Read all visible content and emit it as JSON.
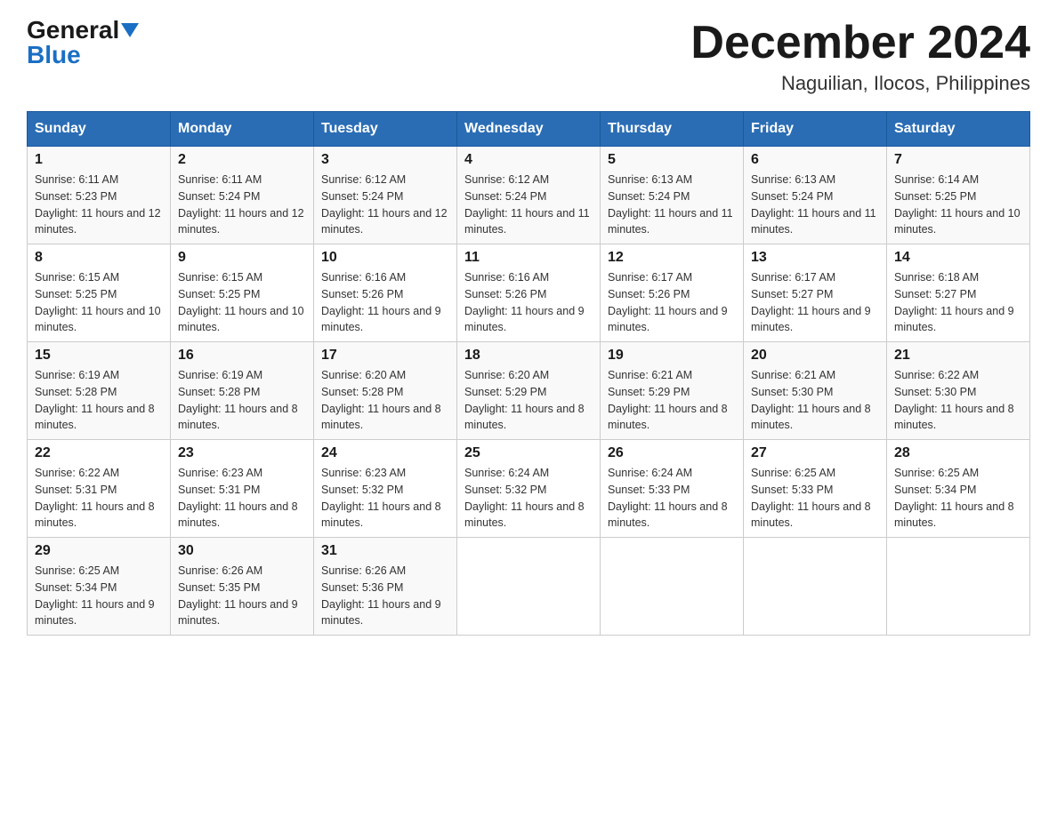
{
  "logo": {
    "general": "General",
    "blue": "Blue"
  },
  "title": {
    "month_year": "December 2024",
    "location": "Naguilian, Ilocos, Philippines"
  },
  "days_of_week": [
    "Sunday",
    "Monday",
    "Tuesday",
    "Wednesday",
    "Thursday",
    "Friday",
    "Saturday"
  ],
  "weeks": [
    [
      {
        "day": "1",
        "sunrise": "6:11 AM",
        "sunset": "5:23 PM",
        "daylight": "11 hours and 12 minutes."
      },
      {
        "day": "2",
        "sunrise": "6:11 AM",
        "sunset": "5:24 PM",
        "daylight": "11 hours and 12 minutes."
      },
      {
        "day": "3",
        "sunrise": "6:12 AM",
        "sunset": "5:24 PM",
        "daylight": "11 hours and 12 minutes."
      },
      {
        "day": "4",
        "sunrise": "6:12 AM",
        "sunset": "5:24 PM",
        "daylight": "11 hours and 11 minutes."
      },
      {
        "day": "5",
        "sunrise": "6:13 AM",
        "sunset": "5:24 PM",
        "daylight": "11 hours and 11 minutes."
      },
      {
        "day": "6",
        "sunrise": "6:13 AM",
        "sunset": "5:24 PM",
        "daylight": "11 hours and 11 minutes."
      },
      {
        "day": "7",
        "sunrise": "6:14 AM",
        "sunset": "5:25 PM",
        "daylight": "11 hours and 10 minutes."
      }
    ],
    [
      {
        "day": "8",
        "sunrise": "6:15 AM",
        "sunset": "5:25 PM",
        "daylight": "11 hours and 10 minutes."
      },
      {
        "day": "9",
        "sunrise": "6:15 AM",
        "sunset": "5:25 PM",
        "daylight": "11 hours and 10 minutes."
      },
      {
        "day": "10",
        "sunrise": "6:16 AM",
        "sunset": "5:26 PM",
        "daylight": "11 hours and 9 minutes."
      },
      {
        "day": "11",
        "sunrise": "6:16 AM",
        "sunset": "5:26 PM",
        "daylight": "11 hours and 9 minutes."
      },
      {
        "day": "12",
        "sunrise": "6:17 AM",
        "sunset": "5:26 PM",
        "daylight": "11 hours and 9 minutes."
      },
      {
        "day": "13",
        "sunrise": "6:17 AM",
        "sunset": "5:27 PM",
        "daylight": "11 hours and 9 minutes."
      },
      {
        "day": "14",
        "sunrise": "6:18 AM",
        "sunset": "5:27 PM",
        "daylight": "11 hours and 9 minutes."
      }
    ],
    [
      {
        "day": "15",
        "sunrise": "6:19 AM",
        "sunset": "5:28 PM",
        "daylight": "11 hours and 8 minutes."
      },
      {
        "day": "16",
        "sunrise": "6:19 AM",
        "sunset": "5:28 PM",
        "daylight": "11 hours and 8 minutes."
      },
      {
        "day": "17",
        "sunrise": "6:20 AM",
        "sunset": "5:28 PM",
        "daylight": "11 hours and 8 minutes."
      },
      {
        "day": "18",
        "sunrise": "6:20 AM",
        "sunset": "5:29 PM",
        "daylight": "11 hours and 8 minutes."
      },
      {
        "day": "19",
        "sunrise": "6:21 AM",
        "sunset": "5:29 PM",
        "daylight": "11 hours and 8 minutes."
      },
      {
        "day": "20",
        "sunrise": "6:21 AM",
        "sunset": "5:30 PM",
        "daylight": "11 hours and 8 minutes."
      },
      {
        "day": "21",
        "sunrise": "6:22 AM",
        "sunset": "5:30 PM",
        "daylight": "11 hours and 8 minutes."
      }
    ],
    [
      {
        "day": "22",
        "sunrise": "6:22 AM",
        "sunset": "5:31 PM",
        "daylight": "11 hours and 8 minutes."
      },
      {
        "day": "23",
        "sunrise": "6:23 AM",
        "sunset": "5:31 PM",
        "daylight": "11 hours and 8 minutes."
      },
      {
        "day": "24",
        "sunrise": "6:23 AM",
        "sunset": "5:32 PM",
        "daylight": "11 hours and 8 minutes."
      },
      {
        "day": "25",
        "sunrise": "6:24 AM",
        "sunset": "5:32 PM",
        "daylight": "11 hours and 8 minutes."
      },
      {
        "day": "26",
        "sunrise": "6:24 AM",
        "sunset": "5:33 PM",
        "daylight": "11 hours and 8 minutes."
      },
      {
        "day": "27",
        "sunrise": "6:25 AM",
        "sunset": "5:33 PM",
        "daylight": "11 hours and 8 minutes."
      },
      {
        "day": "28",
        "sunrise": "6:25 AM",
        "sunset": "5:34 PM",
        "daylight": "11 hours and 8 minutes."
      }
    ],
    [
      {
        "day": "29",
        "sunrise": "6:25 AM",
        "sunset": "5:34 PM",
        "daylight": "11 hours and 9 minutes."
      },
      {
        "day": "30",
        "sunrise": "6:26 AM",
        "sunset": "5:35 PM",
        "daylight": "11 hours and 9 minutes."
      },
      {
        "day": "31",
        "sunrise": "6:26 AM",
        "sunset": "5:36 PM",
        "daylight": "11 hours and 9 minutes."
      },
      null,
      null,
      null,
      null
    ]
  ],
  "labels": {
    "sunrise": "Sunrise: ",
    "sunset": "Sunset: ",
    "daylight": "Daylight: "
  }
}
